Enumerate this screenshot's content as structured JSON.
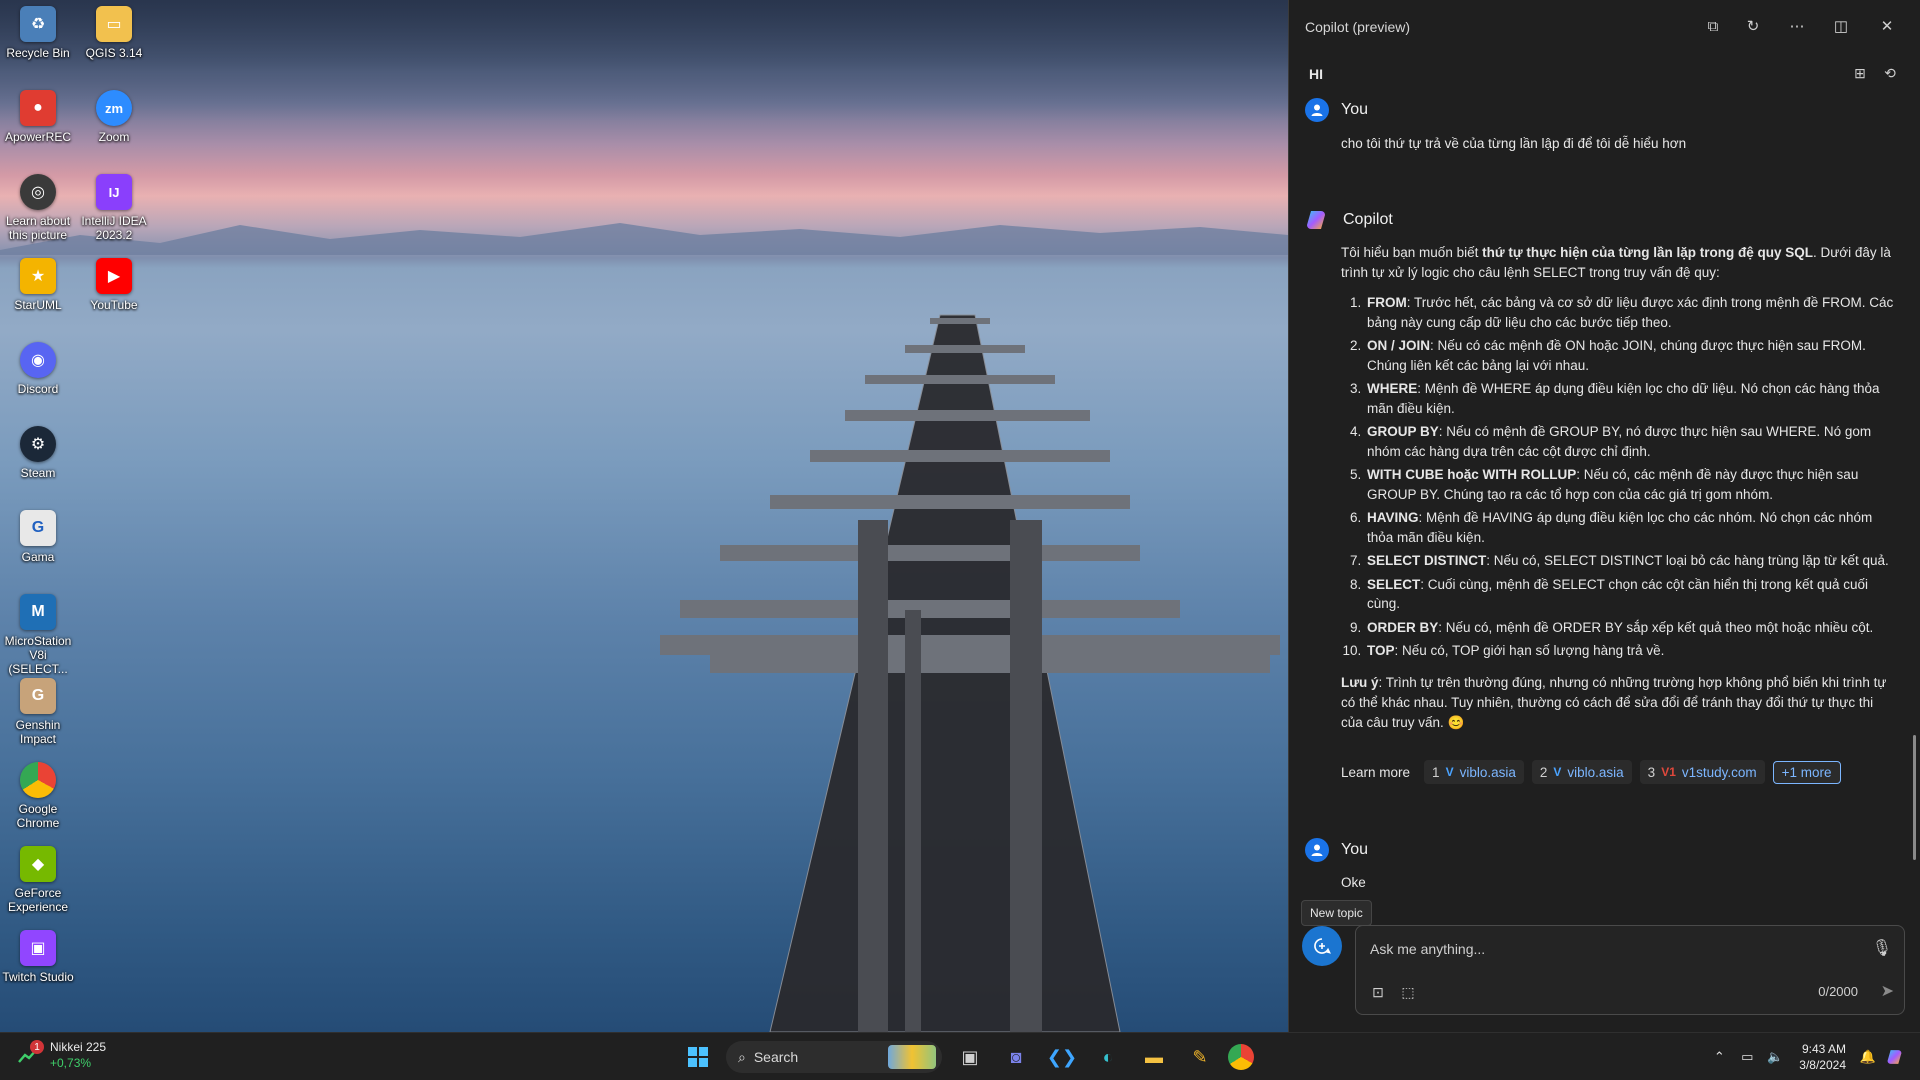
{
  "desktop": {
    "icons": [
      {
        "label": "Recycle Bin",
        "icon": "recycle-bin-icon",
        "color": "#4a7fb8",
        "glyph": "♻"
      },
      {
        "label": "QGIS 3.14",
        "icon": "folder-icon",
        "color": "#f2c14e",
        "glyph": "▭"
      },
      {
        "label": "ApowerREC",
        "icon": "apowerrec-icon",
        "color": "#e03c31",
        "glyph": "●"
      },
      {
        "label": "Zoom",
        "icon": "zoom-icon",
        "color": "#2d8cff",
        "glyph": "zm"
      },
      {
        "label": "Learn about this picture",
        "icon": "learn-picture-icon",
        "color": "#3a3a3a",
        "glyph": "◎"
      },
      {
        "label": "IntelliJ IDEA 2023.2",
        "icon": "intellij-icon",
        "color": "#8a3ffc",
        "glyph": "IJ"
      },
      {
        "label": "StarUML",
        "icon": "staruml-icon",
        "color": "#f4b400",
        "glyph": "★"
      },
      {
        "label": "YouTube",
        "icon": "youtube-icon",
        "color": "#ff0000",
        "glyph": "▶"
      },
      {
        "label": "Discord",
        "icon": "discord-icon",
        "color": "#5865f2",
        "glyph": "◉"
      },
      {
        "label": "Steam",
        "icon": "steam-icon",
        "color": "#1b2838",
        "glyph": "⚙"
      },
      {
        "label": "Gama",
        "icon": "gama-icon",
        "color": "#e8e8e8",
        "glyph": "G"
      },
      {
        "label": "MicroStation V8i (SELECT...",
        "icon": "microstation-icon",
        "color": "#1f6fb5",
        "glyph": "M"
      },
      {
        "label": "Genshin Impact",
        "icon": "genshin-icon",
        "color": "#c7a37a",
        "glyph": "G"
      },
      {
        "label": "Google Chrome",
        "icon": "chrome-icon",
        "color": "#34a853",
        "glyph": "◍"
      },
      {
        "label": "GeForce Experience",
        "icon": "geforce-icon",
        "color": "#76b900",
        "glyph": "◆"
      },
      {
        "label": "Twitch Studio",
        "icon": "twitch-icon",
        "color": "#9146ff",
        "glyph": "▣"
      }
    ]
  },
  "copilot": {
    "title": "Copilot (preview)",
    "conversation_title": "HI",
    "header_icons": [
      "open-external-icon",
      "refresh-icon",
      "more-icon",
      "sidebar-icon",
      "close-icon"
    ],
    "messages": [
      {
        "author": "You",
        "text": "cho tôi thứ tự trả về của từng lần lập đi để tôi dễ hiểu hơn"
      },
      {
        "author": "Copilot"
      },
      {
        "author": "You",
        "text": "Oke"
      }
    ],
    "answer": {
      "intro_pre": "Tôi hiểu bạn muốn biết ",
      "intro_bold": "thứ tự thực hiện của từng lần lặp trong đệ quy SQL",
      "intro_post": ". Dưới đây là trình tự xử lý logic cho câu lệnh SELECT trong truy vấn đệ quy:",
      "steps": [
        {
          "term": "FROM",
          "text": ": Trước hết, các bảng và cơ sở dữ liệu được xác định trong mệnh đề FROM. Các bảng này cung cấp dữ liệu cho các bước tiếp theo."
        },
        {
          "term": "ON / JOIN",
          "text": ": Nếu có các mệnh đề ON hoặc JOIN, chúng được thực hiện sau FROM. Chúng liên kết các bảng lại với nhau."
        },
        {
          "term": "WHERE",
          "text": ": Mệnh đề WHERE áp dụng điều kiện lọc cho dữ liệu. Nó chọn các hàng thỏa mãn điều kiện."
        },
        {
          "term": "GROUP BY",
          "text": ": Nếu có mệnh đề GROUP BY, nó được thực hiện sau WHERE. Nó gom nhóm các hàng dựa trên các cột được chỉ định."
        },
        {
          "term": "WITH CUBE hoặc WITH ROLLUP",
          "text": ": Nếu có, các mệnh đề này được thực hiện sau GROUP BY. Chúng tạo ra các tổ hợp con của các giá trị gom nhóm."
        },
        {
          "term": "HAVING",
          "text": ": Mệnh đề HAVING áp dụng điều kiện lọc cho các nhóm. Nó chọn các nhóm thỏa mãn điều kiện."
        },
        {
          "term": "SELECT DISTINCT",
          "text": ": Nếu có, SELECT DISTINCT loại bỏ các hàng trùng lặp từ kết quả."
        },
        {
          "term": "SELECT",
          "text": ": Cuối cùng, mệnh đề SELECT chọn các cột cần hiển thị trong kết quả cuối cùng."
        },
        {
          "term": "ORDER BY",
          "text": ": Nếu có, mệnh đề ORDER BY sắp xếp kết quả theo một hoặc nhiều cột."
        },
        {
          "term": "TOP",
          "text": ": Nếu có, TOP giới hạn số lượng hàng trả về."
        }
      ],
      "note_bold": "Lưu ý",
      "note_text": ": Trình tự trên thường đúng, nhưng có những trường hợp không phổ biến khi trình tự có thể khác nhau. Tuy nhiên, thường có cách để sửa đổi để tránh thay đổi thứ tự thực thi của câu truy vấn. 😊"
    },
    "learn_more": {
      "label": "Learn more",
      "sources": [
        {
          "num": "1",
          "favicon": "V",
          "site": "viblo.asia"
        },
        {
          "num": "2",
          "favicon": "V",
          "site": "viblo.asia"
        },
        {
          "num": "3",
          "favicon": "V1",
          "site": "v1study.com"
        }
      ],
      "more": "+1 more"
    },
    "tooltip": "New topic",
    "input": {
      "placeholder": "Ask me anything...",
      "counter": "0/2000"
    }
  },
  "taskbar": {
    "widget": {
      "badge": "1",
      "name": "Nikkei 225",
      "value": "+0,73%"
    },
    "search_label": "Search",
    "apps": [
      "task-view-icon",
      "teams-chat-icon",
      "vscode-icon",
      "edge-icon",
      "file-explorer-icon",
      "paint-icon",
      "chrome-icon"
    ],
    "clock": {
      "time": "9:43 AM",
      "date": "3/8/2024"
    }
  }
}
